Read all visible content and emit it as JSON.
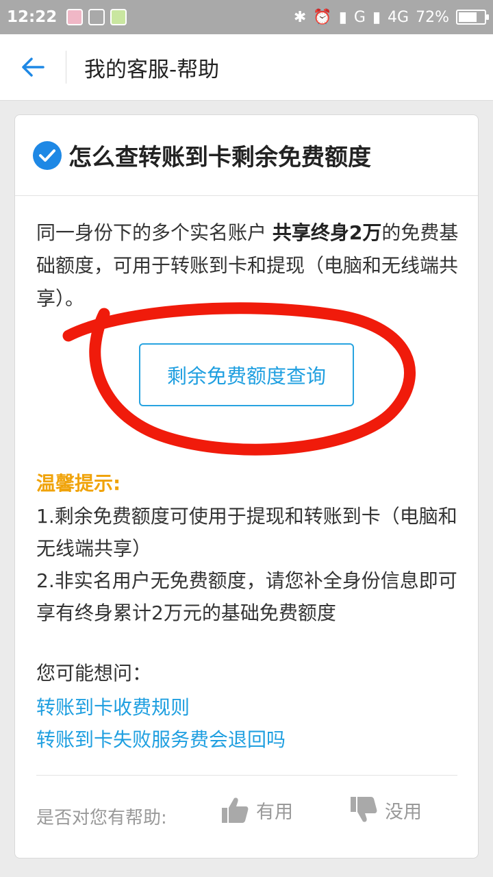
{
  "status_bar": {
    "time": "12:22",
    "network_1": "G",
    "network_2": "4G",
    "battery": "72%",
    "battery_level": 0.72
  },
  "header": {
    "back_icon": "arrow-left-icon",
    "title": "我的客服-帮助"
  },
  "card": {
    "title": "怎么查转账到卡剩余免费额度",
    "intro_part1": "同一身份下的多个实名账户 ",
    "intro_bold": "共享终身2万",
    "intro_part2": "的免费基础额度，可用于转账到卡和提现（电脑和无线端共享）。",
    "query_button": "剩余免费额度查询",
    "tips_title": "温馨提示:",
    "tips": [
      "1.剩余免费额度可使用于提现和转账到卡（电脑和无线端共享）",
      "2.非实名用户无免费额度，请您补全身份信息即可享有终身累计2万元的基础免费额度"
    ],
    "faq_label": "您可能想问：",
    "faq_links": [
      "转账到卡收费规则",
      "转账到卡失败服务费会退回吗"
    ],
    "helpful_label": "是否对您有帮助:",
    "useful_label": "有用",
    "useless_label": "没用"
  },
  "colors": {
    "accent": "#1e88e5",
    "link": "#1f9fe0",
    "tip": "#f0a30a",
    "scribble": "#f01b0b"
  }
}
